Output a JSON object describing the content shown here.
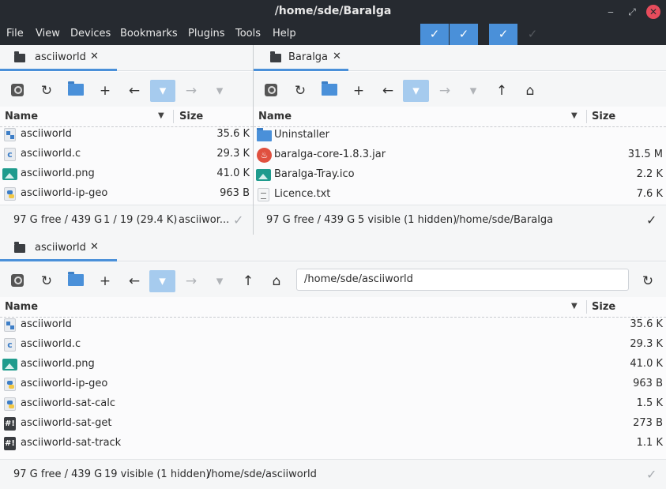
{
  "window": {
    "title": "/home/sde/Baralga"
  },
  "menu": [
    "File",
    "View",
    "Devices",
    "Bookmarks",
    "Plugins",
    "Tools",
    "Help"
  ],
  "toggles": [
    "✓",
    "✓",
    "✓",
    "✓"
  ],
  "panes": {
    "left": {
      "tab": "asciiworld",
      "columns": {
        "name": "Name",
        "size": "Size"
      },
      "rows": [
        {
          "name": "asciiworld",
          "size": "35.6 K",
          "icon": "executable-icon"
        },
        {
          "name": "asciiworld.c",
          "size": "29.3 K",
          "icon": "c-source-icon"
        },
        {
          "name": "asciiworld.png",
          "size": "41.0 K",
          "icon": "image-icon"
        },
        {
          "name": "asciiworld-ip-geo",
          "size": "963 B",
          "icon": "python-icon"
        }
      ],
      "status": {
        "free": "97 G free / 439 G",
        "selection": "1 / 19 (29.4 K)",
        "current": "asciiwor..."
      }
    },
    "right": {
      "tab": "Baralga",
      "columns": {
        "name": "Name",
        "size": "Size"
      },
      "rows": [
        {
          "name": "Uninstaller",
          "size": "",
          "icon": "folder-icon"
        },
        {
          "name": "baralga-core-1.8.3.jar",
          "size": "31.5 M",
          "icon": "java-icon"
        },
        {
          "name": "Baralga-Tray.ico",
          "size": "2.2 K",
          "icon": "image-icon"
        },
        {
          "name": "Licence.txt",
          "size": "7.6 K",
          "icon": "text-file-icon"
        }
      ],
      "status": {
        "free": "97 G free / 439 G",
        "visible": "5 visible (1 hidden)",
        "path": "/home/sde/Baralga"
      }
    },
    "bottom": {
      "tab": "asciiworld",
      "address": "/home/sde/asciiworld",
      "columns": {
        "name": "Name",
        "size": "Size"
      },
      "rows": [
        {
          "name": "asciiworld",
          "size": "35.6 K",
          "icon": "executable-icon"
        },
        {
          "name": "asciiworld.c",
          "size": "29.3 K",
          "icon": "c-source-icon"
        },
        {
          "name": "asciiworld.png",
          "size": "41.0 K",
          "icon": "image-icon"
        },
        {
          "name": "asciiworld-ip-geo",
          "size": "963 B",
          "icon": "python-icon"
        },
        {
          "name": "asciiworld-sat-calc",
          "size": "1.5 K",
          "icon": "python-icon"
        },
        {
          "name": "asciiworld-sat-get",
          "size": "273 B",
          "icon": "shell-script-icon"
        },
        {
          "name": "asciiworld-sat-track",
          "size": "1.1 K",
          "icon": "shell-script-icon"
        }
      ],
      "status": {
        "free": "97 G free / 439 G",
        "visible": "19 visible (1 hidden)",
        "path": "/home/sde/asciiworld"
      }
    }
  },
  "colors": {
    "accent": "#4a90d9",
    "titlebar": "#262a30",
    "close": "#e74c5c"
  }
}
